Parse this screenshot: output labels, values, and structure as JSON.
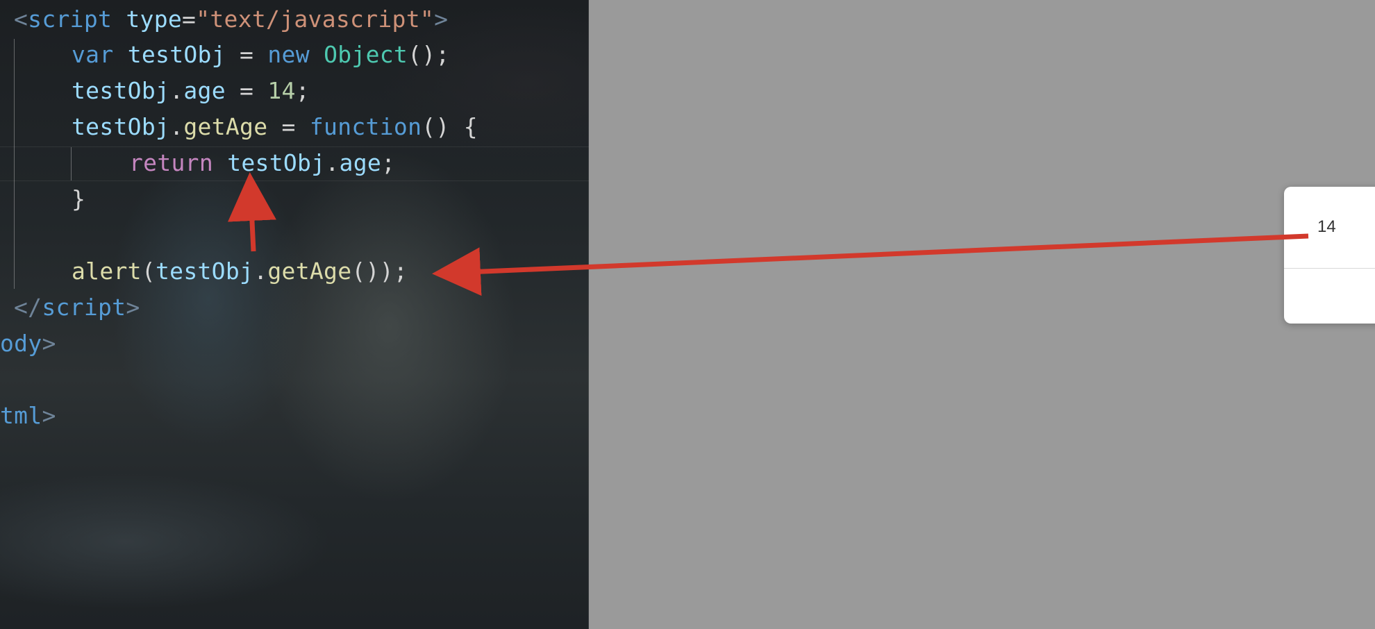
{
  "editor": {
    "line1": {
      "open": "<",
      "tag": "script",
      "attr": "type",
      "eq": "=",
      "val": "\"text/javascript\"",
      "close": ">"
    },
    "line2": {
      "kw": "var",
      "var": "testObj",
      "eq": "=",
      "new": "new",
      "cls": "Object",
      "tail": "();"
    },
    "line3": {
      "obj": "testObj",
      "dot": ".",
      "prop": "age",
      "eq": "=",
      "num": "14",
      "semi": ";"
    },
    "line4": {
      "obj": "testObj",
      "dot": ".",
      "fn": "getAge",
      "eq": "=",
      "kw": "function",
      "tail": "() {"
    },
    "line5": {
      "ret": "return",
      "obj": "testObj",
      "dot": ".",
      "prop": "age",
      "semi": ";"
    },
    "line6": {
      "brace": "}"
    },
    "line8": {
      "fn": "alert",
      "open": "(",
      "obj": "testObj",
      "dot": ".",
      "call": "getAge",
      "tail": "());"
    },
    "line9": {
      "open": "</",
      "tag": "script",
      "close": ">"
    },
    "line10": {
      "tag": "ody",
      "close": ">"
    },
    "line12": {
      "tag": "tml",
      "close": ">"
    }
  },
  "dialog": {
    "message": "14"
  },
  "colors": {
    "arrow": "#d2392c",
    "overlay": "#9a9a9a"
  }
}
